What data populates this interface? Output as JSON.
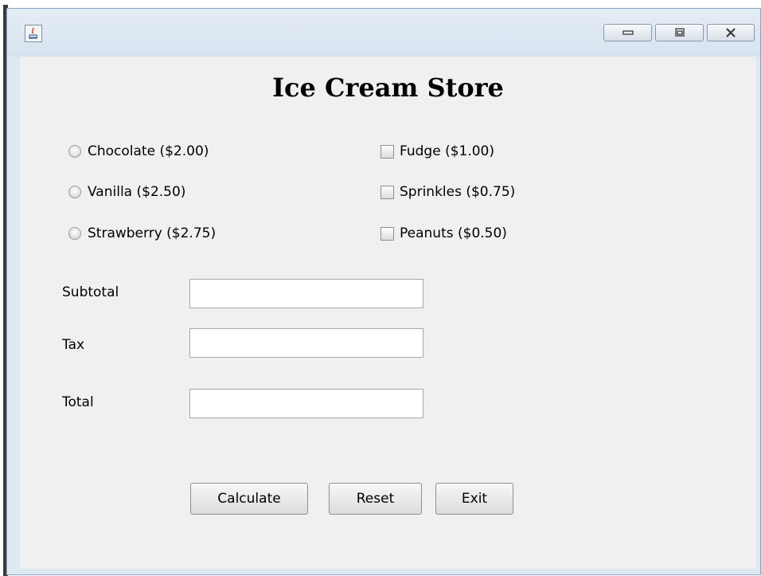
{
  "window": {
    "app_icon": "java-icon",
    "controls": [
      "minimize-icon",
      "maximize-icon",
      "close-icon"
    ]
  },
  "title": "Ice Cream Store",
  "flavors": [
    {
      "label": "Chocolate ($2.00)",
      "selected": false
    },
    {
      "label": "Vanilla ($2.50)",
      "selected": false
    },
    {
      "label": "Strawberry ($2.75)",
      "selected": false
    }
  ],
  "toppings": [
    {
      "label": "Fudge ($1.00)",
      "checked": false
    },
    {
      "label": "Sprinkles ($0.75)",
      "checked": false
    },
    {
      "label": "Peanuts ($0.50)",
      "checked": false
    }
  ],
  "fields": {
    "subtotal": {
      "label": "Subtotal",
      "value": ""
    },
    "tax": {
      "label": "Tax",
      "value": ""
    },
    "total": {
      "label": "Total",
      "value": ""
    }
  },
  "buttons": {
    "calculate": "Calculate",
    "reset": "Reset",
    "exit": "Exit"
  }
}
